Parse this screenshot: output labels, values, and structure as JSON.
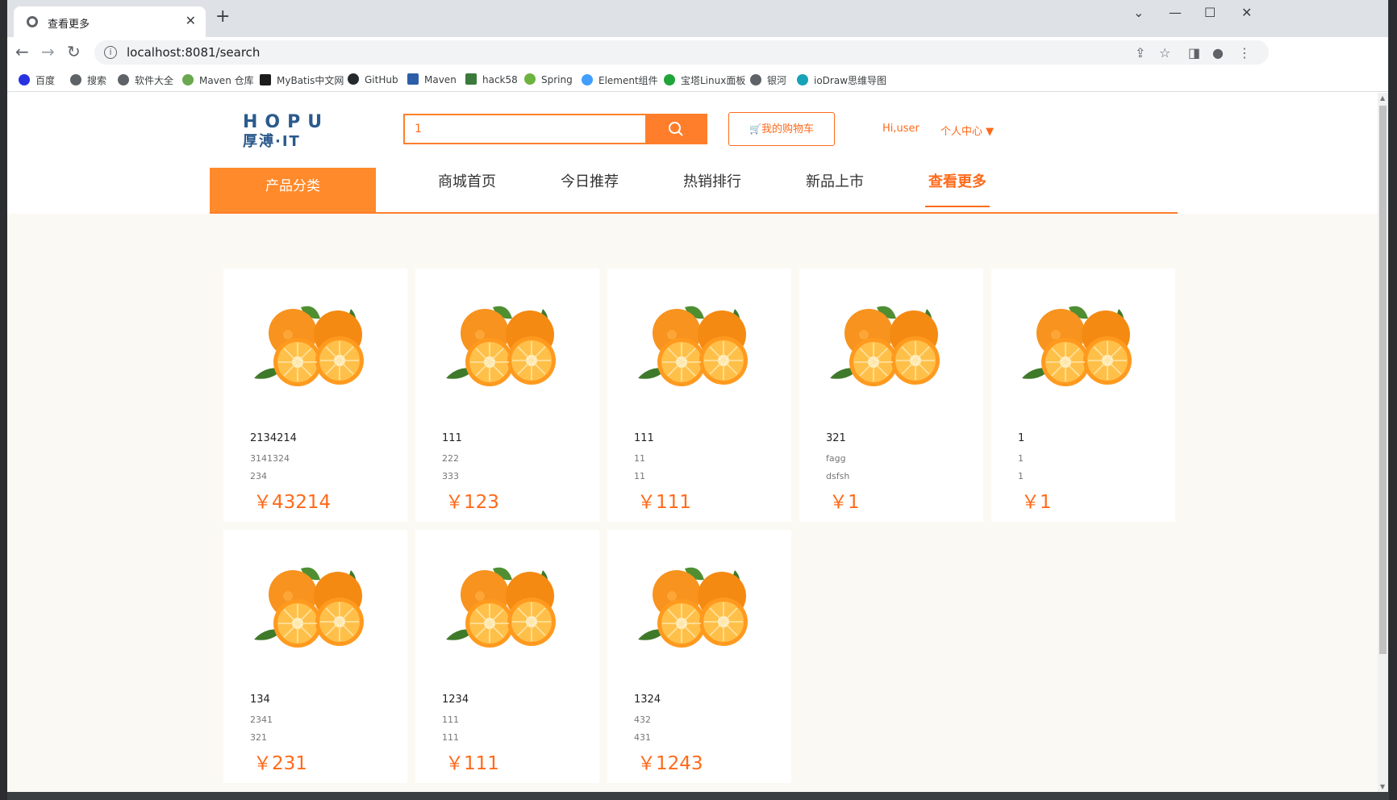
{
  "browser": {
    "tab_title": "查看更多",
    "url": "localhost:8081/search",
    "bookmarks": [
      {
        "label": "百度",
        "color": "#2932e1"
      },
      {
        "label": "搜索",
        "color": "#5f6368"
      },
      {
        "label": "软件大全",
        "color": "#5f6368"
      },
      {
        "label": "Maven 仓库",
        "color": "#6aa84f"
      },
      {
        "label": "MyBatis中文网",
        "color": "#1b1b1b"
      },
      {
        "label": "GitHub",
        "color": "#24292e"
      },
      {
        "label": "Maven",
        "color": "#2d5fa8"
      },
      {
        "label": "hack58",
        "color": "#3b7a3b"
      },
      {
        "label": "Spring",
        "color": "#6db33f"
      },
      {
        "label": "Element组件",
        "color": "#409eff"
      },
      {
        "label": "宝塔Linux面板",
        "color": "#20a53a"
      },
      {
        "label": "银河",
        "color": "#5f6368"
      },
      {
        "label": "ioDraw思维导图",
        "color": "#17a2b8"
      }
    ]
  },
  "header": {
    "logo_en": "HOPU",
    "logo_cn": "厚溥·IT",
    "search_value": "1",
    "cart_label": "我的购物车",
    "user_greet": "Hi,user",
    "user_center": "个人中心 ▼"
  },
  "nav": {
    "category": "产品分类",
    "items": [
      "商城首页",
      "今日推荐",
      "热销排行",
      "新品上市",
      "查看更多"
    ],
    "active_index": 4
  },
  "products": [
    {
      "name": "2134214",
      "desc1": "3141324",
      "desc2": "234",
      "price": "￥43214"
    },
    {
      "name": "111",
      "desc1": "222",
      "desc2": "333",
      "price": "￥123"
    },
    {
      "name": "111",
      "desc1": "11",
      "desc2": "11",
      "price": "￥111"
    },
    {
      "name": "321",
      "desc1": "fagg",
      "desc2": "dsfsh",
      "price": "￥1"
    },
    {
      "name": "1",
      "desc1": "1",
      "desc2": "1",
      "price": "￥1"
    },
    {
      "name": "134",
      "desc1": "2341",
      "desc2": "321",
      "price": "￥231"
    },
    {
      "name": "1234",
      "desc1": "111",
      "desc2": "111",
      "price": "￥111"
    },
    {
      "name": "1324",
      "desc1": "432",
      "desc2": "431",
      "price": "￥1243"
    }
  ],
  "colors": {
    "accent": "#ff7e2b",
    "price": "#ff6a1a",
    "content_bg": "#fbf9f3"
  }
}
